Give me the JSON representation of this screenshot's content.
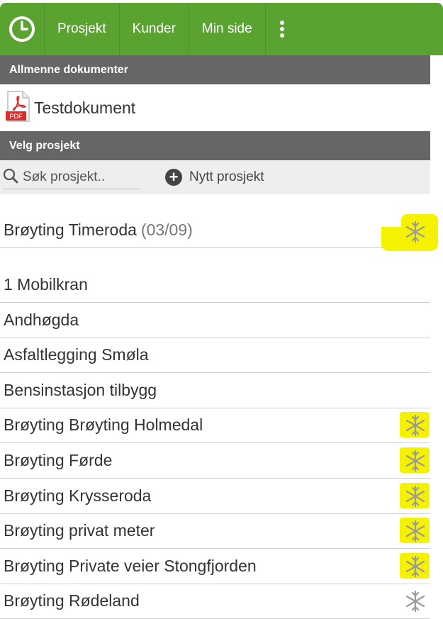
{
  "nav": {
    "items": [
      "Prosjekt",
      "Kunder",
      "Min side"
    ],
    "brand_color": "#5aa331"
  },
  "general_docs": {
    "header": "Allmenne dokumenter",
    "items": [
      {
        "title": "Testdokument",
        "icon": "pdf-icon",
        "icon_label": "PDF"
      }
    ]
  },
  "select_project": {
    "header": "Velg prosjekt",
    "search_placeholder": "Søk prosjekt..",
    "new_project_label": "Nytt prosjekt"
  },
  "active_project": {
    "name": "Brøyting Timeroda",
    "count": "(03/09)",
    "icon": "snowflake-icon"
  },
  "projects": [
    {
      "name": "1 Mobilkran",
      "snow": false
    },
    {
      "name": "Andhøgda",
      "snow": false
    },
    {
      "name": "Asfaltlegging Smøla",
      "snow": false
    },
    {
      "name": "Bensinstasjon tilbygg",
      "snow": false
    },
    {
      "name": "Brøyting Brøyting Holmedal",
      "snow": true
    },
    {
      "name": "Brøyting Førde",
      "snow": true
    },
    {
      "name": "Brøyting Krysseroda",
      "snow": true
    },
    {
      "name": "Brøyting privat meter",
      "snow": true
    },
    {
      "name": "Brøyting Private veier Stongfjorden",
      "snow": true
    },
    {
      "name": "Brøyting Rødeland",
      "snow": true
    }
  ],
  "highlight_color": "#f5f200"
}
